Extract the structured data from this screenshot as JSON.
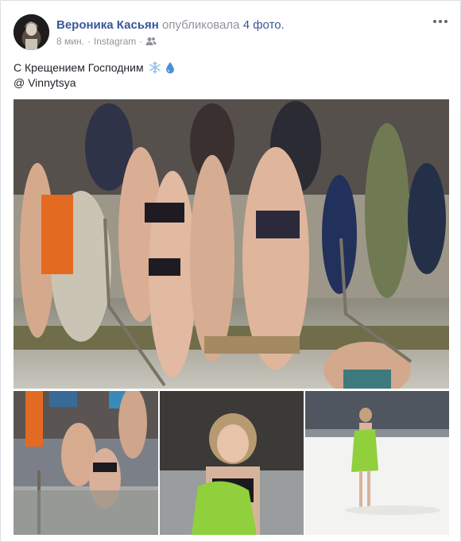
{
  "post": {
    "author": "Вероника Касьян",
    "action": "опубликовала",
    "photo_count": "4 фото.",
    "time": "8 мин.",
    "separator": "·",
    "source": "Instagram",
    "audience_icon": "friends-icon",
    "text": "С Крещением Господним",
    "emojis": [
      "snowflake-icon",
      "droplet-icon"
    ],
    "location": "@ Vinnytsya"
  },
  "colors": {
    "link": "#385898",
    "meta": "#90949c",
    "text": "#1d2129",
    "snow": "#8fbce8",
    "drop": "#4a90d9"
  }
}
